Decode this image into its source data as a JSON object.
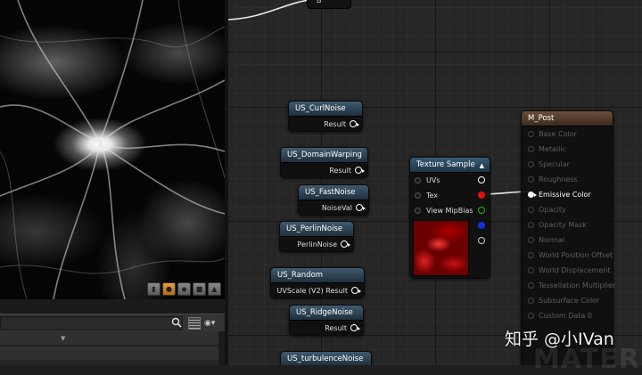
{
  "viewport": {
    "toolbar_icons": [
      "cylinder-icon",
      "sphere-icon",
      "plane-icon",
      "cube-icon",
      "teapot-icon"
    ]
  },
  "graph": {
    "top_stub_label": "B",
    "nodes": [
      {
        "title": "US_CurlNoise",
        "output": "Result"
      },
      {
        "title": "US_DomainWarping",
        "output": "Result"
      },
      {
        "title": "US_FastNoise",
        "output": "NoiseVal"
      },
      {
        "title": "US_PerlinNoise",
        "output": "PerlinNoise"
      },
      {
        "title": "US_Random",
        "output": "UVScale (V2) Result"
      },
      {
        "title": "US_RidgeNoise",
        "output": "Result"
      },
      {
        "title": "US_turbulenceNoise",
        "output": ""
      }
    ],
    "texture_sample": {
      "title": "Texture Sample",
      "inputs": [
        "UVs",
        "Tex",
        "View MipBias"
      ],
      "output_colors": [
        "#ffffff",
        "#e01010",
        "#10c010",
        "#1030e0",
        "#ffffff"
      ]
    },
    "material": {
      "title": "M_Post",
      "inputs": [
        "Base Color",
        "Metallic",
        "Specular",
        "Roughness",
        "Emissive Color",
        "Opacity",
        "Opacity Mask",
        "Normal",
        "World Position Offset",
        "World Displacement",
        "Tessellation Multiplier",
        "Subsurface Color",
        "Custom Data 0"
      ],
      "active_input": "Emissive Color"
    }
  },
  "watermark": {
    "text": "知乎 @小IVan",
    "background_text": "MATERI"
  }
}
